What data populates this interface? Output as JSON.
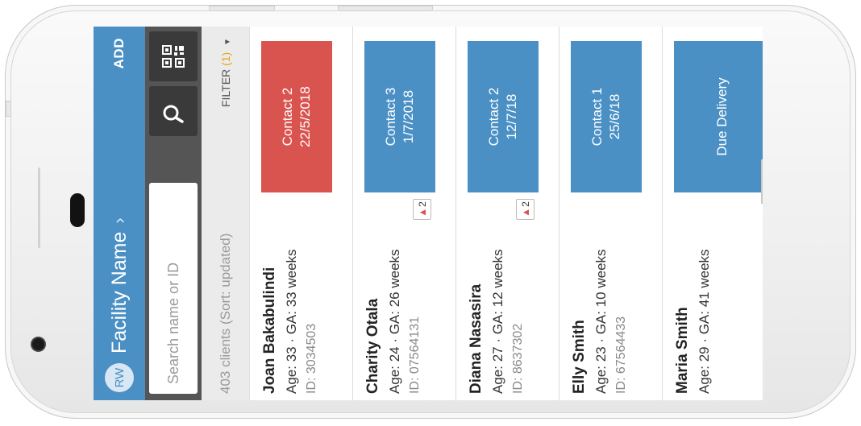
{
  "header": {
    "avatar": "RW",
    "facility_name": "Facility Name",
    "chevron": "›",
    "add_label": "ADD"
  },
  "search": {
    "placeholder": "Search name or ID"
  },
  "list_meta": {
    "count_label": "403 clients (Sort: updated)",
    "filter_label": "FILTER",
    "filter_count": "(1)",
    "filter_caret": "▼"
  },
  "clients": [
    {
      "name": "Joan Bakabulindi",
      "meta": "Age: 33 · GA: 33 weeks",
      "id": "ID: 3034503",
      "alert": "",
      "badge_line1": "Contact 2",
      "badge_line2": "22/5/2018",
      "badge_color": "#d9534f"
    },
    {
      "name": "Charity Otala",
      "meta": "Age: 24 · GA: 26 weeks",
      "id": "ID: 07564131",
      "alert": "2",
      "badge_line1": "Contact 3",
      "badge_line2": "1/7/2018",
      "badge_color": "#4a90c5"
    },
    {
      "name": "Diana Nasasira",
      "meta": "Age: 27 · GA: 12 weeks",
      "id": "ID: 8637302",
      "alert": "2",
      "badge_line1": "Contact 2",
      "badge_line2": "12/7/18",
      "badge_color": "#4a90c5"
    },
    {
      "name": "Elly Smith",
      "meta": "Age: 23 · GA: 10 weeks",
      "id": "ID: 67564433",
      "alert": "",
      "badge_line1": "Contact 1",
      "badge_line2": "25/6/18",
      "badge_color": "#4a90c5"
    },
    {
      "name": "Maria Smith",
      "meta": "Age: 29 · GA: 41 weeks",
      "id": "",
      "alert": "",
      "badge_line1": "Due Delivery",
      "badge_line2": "",
      "badge_color": "#4a90c5"
    }
  ],
  "icons": {
    "search": "search-icon",
    "qr": "qr-code-icon",
    "alert": "warning-icon"
  },
  "colors": {
    "primary": "#4a90c5",
    "danger": "#d9534f",
    "toolbar": "#555555"
  }
}
